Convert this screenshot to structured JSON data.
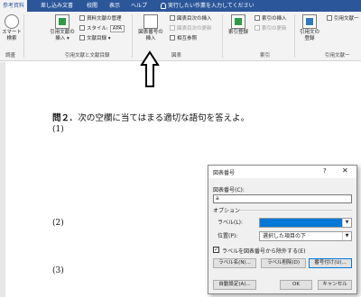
{
  "ribbon": {
    "tabs": [
      {
        "label": "参考資料",
        "active": true
      },
      {
        "label": "差し込み文書",
        "active": false
      },
      {
        "label": "校閲",
        "active": false
      },
      {
        "label": "表示",
        "active": false
      },
      {
        "label": "ヘルプ",
        "active": false
      }
    ],
    "tell_me": "実行したい作業を入力してください",
    "groups": {
      "search": {
        "button": "スマート\n検索",
        "label": "調査"
      },
      "citation": {
        "insert_citation": "引用文献の\n挿入 ▾",
        "manage_sources": "資料文献の管理",
        "style_label": "スタイル:",
        "style_value": "APA",
        "bibliography": "文献目録 ▾",
        "label": "引用文献と文献目録"
      },
      "captions": {
        "insert_caption": "図表番号の\n挿入",
        "insert_table_of_figures": "図表目次の挿入",
        "update_table": "図表目次の更新",
        "cross_reference": "相互参照",
        "label": "図表"
      },
      "index": {
        "mark_entry": "索引登録",
        "insert_index": "索引の挿入",
        "update_index": "索引の更新",
        "label": "索引"
      },
      "authorities": {
        "mark_citation": "引用文の\n登録",
        "insert_table": "引用文献一",
        "label": "引用文献一"
      }
    }
  },
  "document": {
    "question_number": "問２.",
    "question_text": "次の空欄に当てはまる適切な語句を答えよ。",
    "items": [
      "(1)",
      "(2)",
      "(3)"
    ]
  },
  "dialog": {
    "title": "図表番号",
    "help": "?",
    "close": "✕",
    "caption_label": "図表番号(C):",
    "caption_value": "a",
    "options_label": "オプション",
    "label_label": "ラベル(L):",
    "label_value": "",
    "position_label": "位置(P):",
    "position_value": "選択した項目の下",
    "exclude_label": "ラベルを図表番号から除外する(E)",
    "exclude_checked": true,
    "btn_new_label": "ラベル名(N)...",
    "btn_delete_label": "ラベル削除(D)",
    "btn_numbering": "番号付け(U)...",
    "btn_autocaption": "自動設定(A)...",
    "btn_ok": "OK",
    "btn_cancel": "キャンセル"
  }
}
